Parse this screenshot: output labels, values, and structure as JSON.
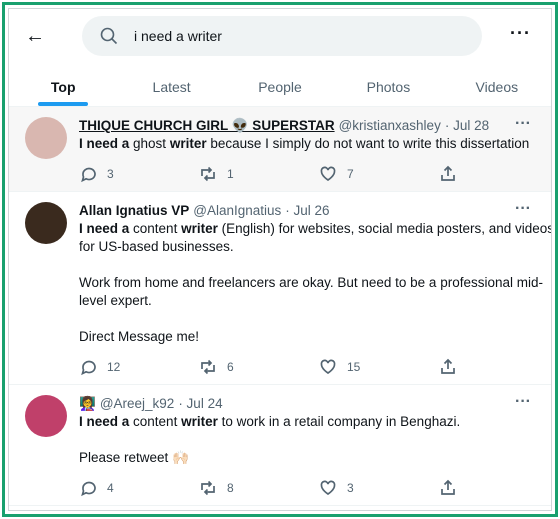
{
  "search": {
    "query": "i need a writer"
  },
  "tabs": [
    {
      "label": "Top",
      "active": true
    },
    {
      "label": "Latest"
    },
    {
      "label": "People"
    },
    {
      "label": "Photos"
    },
    {
      "label": "Videos"
    }
  ],
  "tweets": [
    {
      "name": "THIQUE CHURCH GIRL 👽 SUPERSTAR",
      "handle": "@kristianxashley",
      "date": "· Jul 28",
      "paragraphs": [
        [
          {
            "b": "I need a"
          },
          {
            "t": " ghost "
          },
          {
            "b": "writer"
          },
          {
            "t": " because I simply do not want to write this dissertation"
          }
        ]
      ],
      "replies": "3",
      "retweets": "1",
      "likes": "7",
      "avatar_color": "#d9b7b0"
    },
    {
      "name": "Allan Ignatius VP",
      "handle": "@AlanIgnatius",
      "date": "· Jul 26",
      "paragraphs": [
        [
          {
            "b": "I need a"
          },
          {
            "t": " content "
          },
          {
            "b": "writer"
          },
          {
            "t": " (English) for websites, social media posters, and videos for US-based businesses."
          }
        ],
        [
          {
            "t": "Work from home and freelancers are okay. But need to be a professional mid-level expert."
          }
        ],
        [
          {
            "t": "Direct Message me!"
          }
        ]
      ],
      "replies": "12",
      "retweets": "6",
      "likes": "15",
      "avatar_color": "#3a2a1e"
    },
    {
      "name": "👩‍🏫",
      "handle": "@Areej_k92",
      "date": "· Jul 24",
      "paragraphs": [
        [
          {
            "b": "I need a"
          },
          {
            "t": " content "
          },
          {
            "b": "writer"
          },
          {
            "t": " to work in a retail company in Benghazi."
          }
        ],
        [
          {
            "t": "Please retweet 🙌🏻"
          }
        ]
      ],
      "replies": "4",
      "retweets": "8",
      "likes": "3",
      "avatar_color": "#c0406a"
    }
  ],
  "colors": {
    "accent": "#1d9bf0",
    "frame": "#19a06e"
  }
}
